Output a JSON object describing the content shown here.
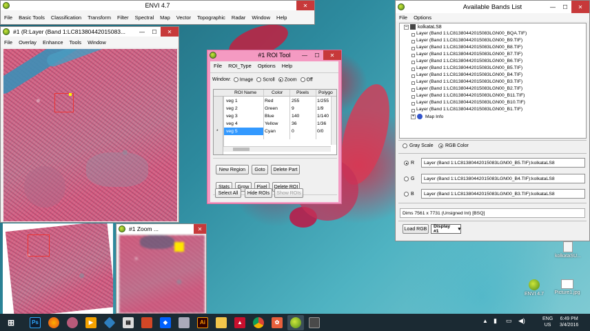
{
  "envi_main": {
    "title": "ENVI 4.7",
    "menu": [
      "File",
      "Basic Tools",
      "Classification",
      "Transform",
      "Filter",
      "Spectral",
      "Map",
      "Vector",
      "Topographic",
      "Radar",
      "Window",
      "Help"
    ]
  },
  "image_window": {
    "title": "#1 (R:Layer (Band 1:LC81380442015083...",
    "menu": [
      "File",
      "Overlay",
      "Enhance",
      "Tools",
      "Window"
    ]
  },
  "zoom_window": {
    "title": "#1 Zoom ..."
  },
  "roi_tool": {
    "title": "#1 ROI Tool",
    "menu": [
      "File",
      "ROI_Type",
      "Options",
      "Help"
    ],
    "window_label": "Window:",
    "window_options": [
      {
        "label": "Image",
        "selected": false
      },
      {
        "label": "Scroll",
        "selected": false
      },
      {
        "label": "Zoom",
        "selected": true
      },
      {
        "label": "Off",
        "selected": false
      }
    ],
    "columns": [
      "ROI Name",
      "Color",
      "Pixels",
      "Polygo"
    ],
    "rows": [
      {
        "marker": "",
        "name": "veg 1",
        "color": "Red",
        "pixels": "255",
        "poly": "1/255"
      },
      {
        "marker": "",
        "name": "veg 2",
        "color": "Green",
        "pixels": "9",
        "poly": "1/9"
      },
      {
        "marker": "",
        "name": "veg 3",
        "color": "Blue",
        "pixels": "140",
        "poly": "1/140"
      },
      {
        "marker": "",
        "name": "veg 4",
        "color": "Yellow",
        "pixels": "36",
        "poly": "1/36"
      },
      {
        "marker": "*",
        "name": "veg 5",
        "color": "Cyan",
        "pixels": "0",
        "poly": "0/0"
      }
    ],
    "buttons_row1": [
      "New Region",
      "Goto",
      "Delete Part"
    ],
    "buttons_row2": [
      "Stats",
      "Grow",
      "Pixel",
      "Delete ROI"
    ],
    "buttons_row3": [
      "Select All",
      "Hide ROIs",
      "Show ROIs"
    ]
  },
  "bands_list": {
    "title": "Available Bands List",
    "menu": [
      "File",
      "Options"
    ],
    "root": "kolkataLS8",
    "bands": [
      "Layer (Band 1:LC81380442015083LGN00_BQA.TIF)",
      "Layer (Band 1:LC81380442015083LGN00_B9.TIF)",
      "Layer (Band 1:LC81380442015083LGN00_B8.TIF)",
      "Layer (Band 1:LC81380442015083LGN00_B7.TIF)",
      "Layer (Band 1:LC81380442015083LGN00_B6.TIF)",
      "Layer (Band 1:LC81380442015083LGN00_B5.TIF)",
      "Layer (Band 1:LC81380442015083LGN00_B4.TIF)",
      "Layer (Band 1:LC81380442015083LGN00_B3.TIF)",
      "Layer (Band 1:LC81380442015083LGN00_B2.TIF)",
      "Layer (Band 1:LC81380442015083LGN00_B11.TIF)",
      "Layer (Band 1:LC81380442015083LGN00_B10.TIF)",
      "Layer (Band 1:LC81380442015083LGN00_B1.TIF)"
    ],
    "map_info": "Map Info",
    "gray_scale": "Gray Scale",
    "rgb_color": "RGB Color",
    "r_label": "R",
    "g_label": "G",
    "b_label": "B",
    "r_value": "Layer (Band 1:LC81380442015083LGN00_B5.TIF):kolkataLS8",
    "g_value": "Layer (Band 1:LC81380442015083LGN00_B4.TIF):kolkataLS8",
    "b_value": "Layer (Band 1:LC81380442015083LGN00_B3.TIF):kolkataLS8",
    "dims": "Dims 7561 x 7731 (Unsigned Int) [BSQ]",
    "load_rgb": "Load RGB",
    "display_select": "Display #1"
  },
  "desktop_icons": [
    {
      "label": "kolkataSU...",
      "icon": "file-icon"
    },
    {
      "label": "ENVI 4.7",
      "icon": "envi-icon"
    },
    {
      "label": "Picture1.jpg",
      "icon": "image-file-icon"
    }
  ],
  "taskbar": {
    "apps": [
      "windows-start",
      "photoshop",
      "firefox",
      "app-4",
      "media-player",
      "app-6",
      "film-strip",
      "slides",
      "dropbox",
      "app-10",
      "illustrator",
      "file-explorer",
      "acrobat",
      "chrome",
      "paint",
      "envi",
      "app-17"
    ],
    "lang_top": "ENG",
    "lang_bottom": "US",
    "time": "6:49 PM",
    "date": "3/4/2016"
  },
  "colors": {
    "close_red": "#c7393a",
    "roi_pink": "#f49ac2",
    "taskbar": "#1b2a33",
    "selection_blue": "#3399ff"
  }
}
